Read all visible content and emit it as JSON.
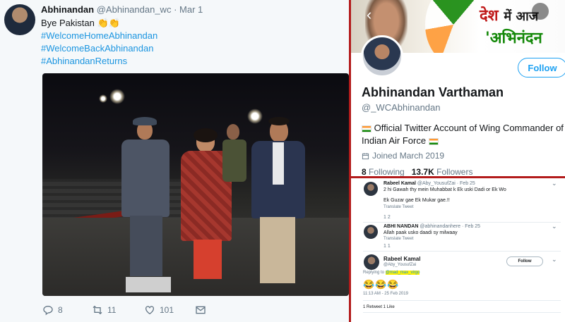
{
  "tweet": {
    "author_name": "Abhinandan",
    "author_handle": "@Abhinandan_wc",
    "separator": "·",
    "date": "Mar 1",
    "text": "Bye Pakistan",
    "emoji": "👏👏",
    "hashtags": [
      "#WelcomeHomeAbhinandan",
      "#WelcomeBackAbhinandan",
      "#AbhinandanReturns"
    ],
    "actions": {
      "reply_count": "8",
      "retweet_count": "11",
      "like_count": "101"
    }
  },
  "profile": {
    "banner_text_1": "देश",
    "banner_text_1b": "में आज",
    "banner_text_2": "'अभिनंदन",
    "follow_label": "Follow",
    "name": "Abhinandan Varthaman",
    "handle": "@_WCAbhinandan",
    "bio": "Official Twitter Account of Wing Commander of Indian Air Force",
    "joined": "Joined March 2019",
    "following_count": "8",
    "following_label": "Following",
    "followers_count": "13.7K",
    "followers_label": "Followers"
  },
  "thread": {
    "reply1": {
      "name": "Rabeel Kamal",
      "meta": "@Aby_YousufZai · Feb 25",
      "line1": "2 hi Gawah thy mein Muhabbat k Ek uski Dadi or Ek Wo",
      "line2": "Ek Guzar gae Ek Mukar gae.!!",
      "translate": "Translate Tweet",
      "counts": "1        2"
    },
    "reply2": {
      "name": "ABHI NANDAN",
      "meta": "@abhinandanhere · Feb 25",
      "line1": "Allah paak usko daadi sy milwaay",
      "translate": "Translate Tweet",
      "counts": "1        1"
    },
    "reply3": {
      "name": "Rabeel Kamal",
      "handle": "@Aby_YousufZai",
      "follow_label": "Follow",
      "replying_prefix": "Replying to",
      "replying_mention": "@mad_max_virgo",
      "emojis": "😂😂😂",
      "time": "11:13 AM - 25 Feb 2019",
      "stats": "1 Retweet   1 Like"
    }
  }
}
